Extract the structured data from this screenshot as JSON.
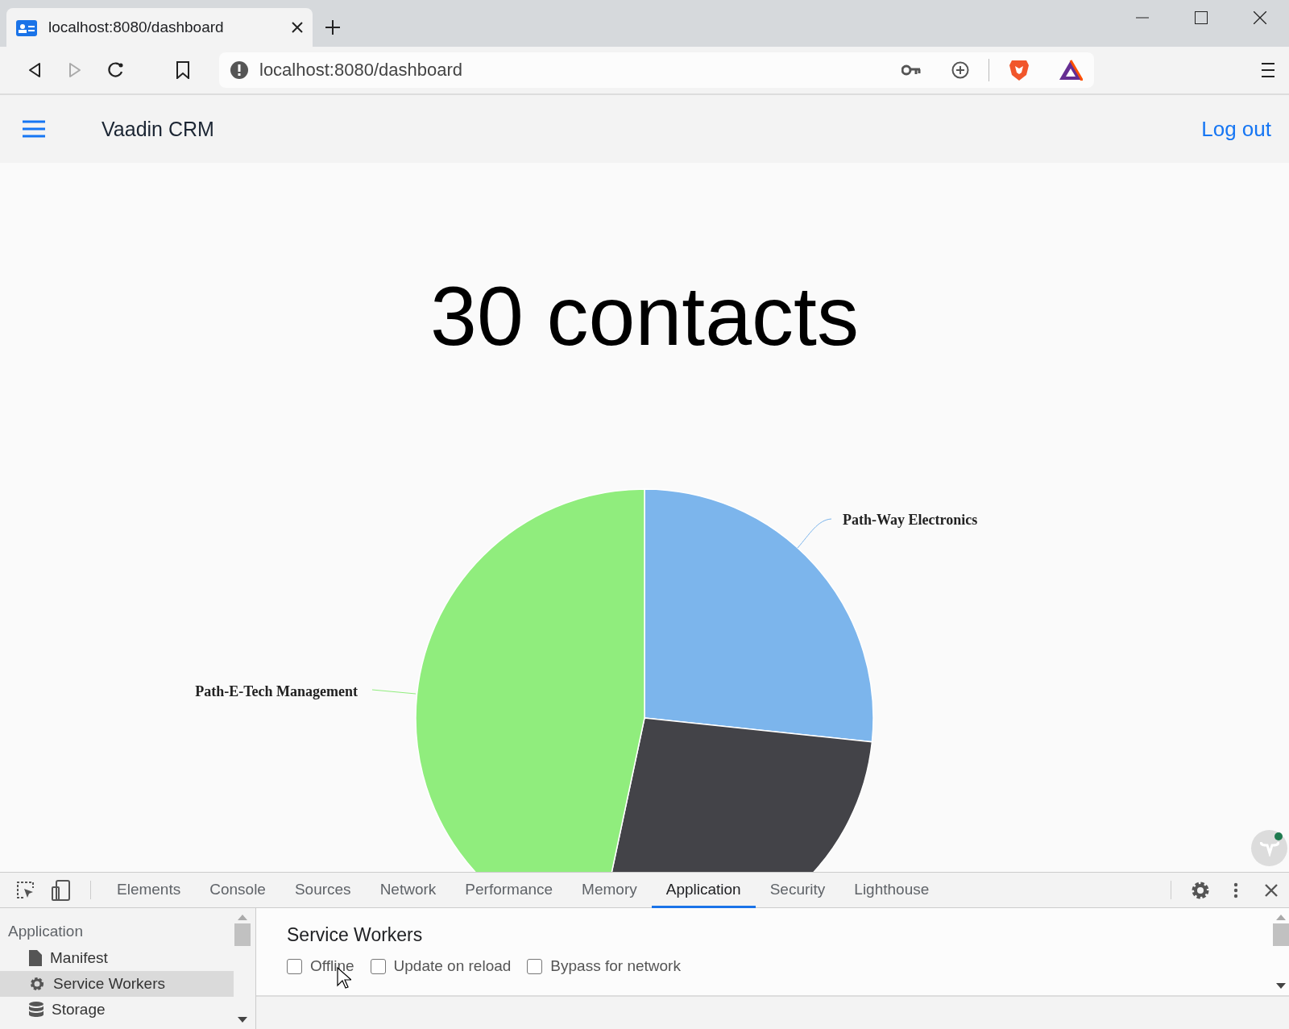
{
  "browser": {
    "tab": {
      "title": "localhost:8080/dashboard"
    },
    "address": "localhost:8080/dashboard"
  },
  "app": {
    "title": "Vaadin CRM",
    "logout": "Log out"
  },
  "dashboard": {
    "heading": "30 contacts",
    "slices": [
      {
        "label": "Path-Way Electronics",
        "color": "#7cb5ec"
      },
      {
        "color": "#434348"
      },
      {
        "label": "Path-E-Tech Management",
        "color": "#90ed7d"
      }
    ]
  },
  "devtools": {
    "tabs": [
      {
        "label": "Elements",
        "selected": false
      },
      {
        "label": "Console",
        "selected": false
      },
      {
        "label": "Sources",
        "selected": false
      },
      {
        "label": "Network",
        "selected": false
      },
      {
        "label": "Performance",
        "selected": false
      },
      {
        "label": "Memory",
        "selected": false
      },
      {
        "label": "Application",
        "selected": true
      },
      {
        "label": "Security",
        "selected": false
      },
      {
        "label": "Lighthouse",
        "selected": false
      }
    ],
    "sidebar": {
      "section": "Application",
      "items": [
        {
          "label": "Manifest",
          "selected": false
        },
        {
          "label": "Service Workers",
          "selected": true
        },
        {
          "label": "Storage",
          "selected": false
        }
      ]
    },
    "panel": {
      "title": "Service Workers",
      "options": [
        {
          "label": "Offline",
          "checked": false
        },
        {
          "label": "Update on reload",
          "checked": false
        },
        {
          "label": "Bypass for network",
          "checked": false
        }
      ]
    }
  }
}
